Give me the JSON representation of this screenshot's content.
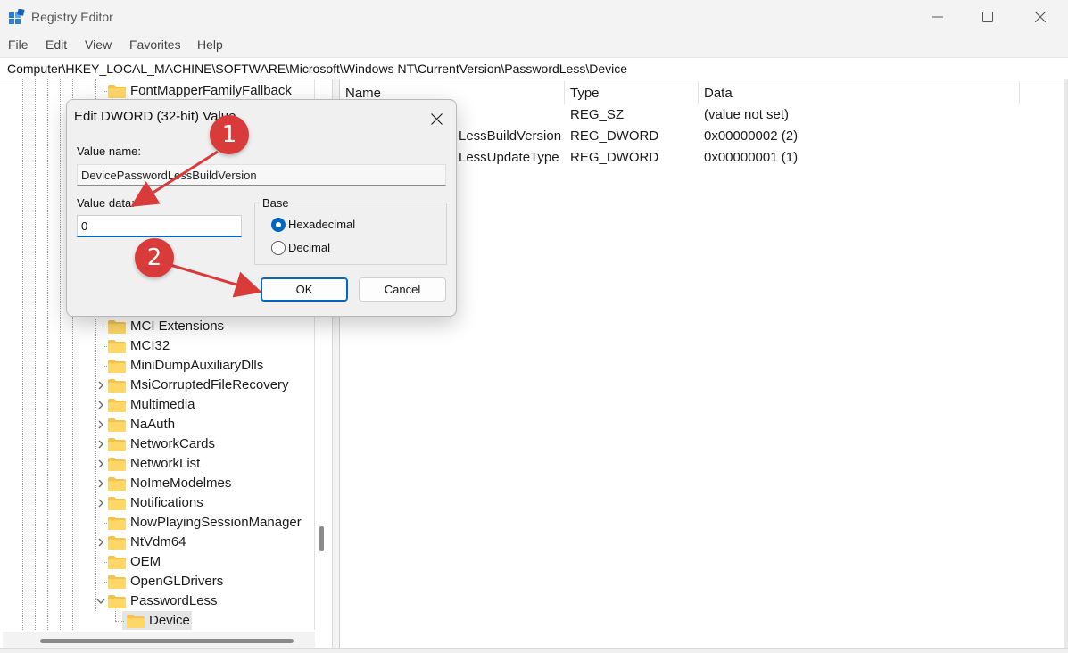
{
  "window": {
    "title": "Registry Editor",
    "icon": "registry-editor-icon",
    "controls": [
      "minimize-icon",
      "maximize-icon",
      "close-icon"
    ]
  },
  "menu": [
    "File",
    "Edit",
    "View",
    "Favorites",
    "Help"
  ],
  "address": "Computer\\HKEY_LOCAL_MACHINE\\SOFTWARE\\Microsoft\\Windows NT\\CurrentVersion\\PasswordLess\\Device",
  "tree": {
    "top_item": "FontMapperFamilyFallback",
    "items": [
      {
        "label": "MCI Extensions",
        "expandable": false
      },
      {
        "label": "MCI32",
        "expandable": false
      },
      {
        "label": "MiniDumpAuxiliaryDlls",
        "expandable": false
      },
      {
        "label": "MsiCorruptedFileRecovery",
        "expandable": true
      },
      {
        "label": "Multimedia",
        "expandable": true
      },
      {
        "label": "NaAuth",
        "expandable": true
      },
      {
        "label": "NetworkCards",
        "expandable": true
      },
      {
        "label": "NetworkList",
        "expandable": true
      },
      {
        "label": "NoImeModelmes",
        "expandable": true
      },
      {
        "label": "Notifications",
        "expandable": true
      },
      {
        "label": "NowPlayingSessionManager",
        "expandable": false
      },
      {
        "label": "NtVdm64",
        "expandable": true
      },
      {
        "label": "OEM",
        "expandable": false
      },
      {
        "label": "OpenGLDrivers",
        "expandable": false
      },
      {
        "label": "PasswordLess",
        "expandable": true,
        "expanded": true
      },
      {
        "label": "Device",
        "selected": true
      }
    ]
  },
  "list": {
    "headers": {
      "name": "Name",
      "type": "Type",
      "data": "Data"
    },
    "rows": [
      {
        "name": "",
        "type": "REG_SZ",
        "data": "(value not set)"
      },
      {
        "name": "LessBuildVersion",
        "type": "REG_DWORD",
        "data": "0x00000002 (2)"
      },
      {
        "name": "LessUpdateType",
        "type": "REG_DWORD",
        "data": "0x00000001 (1)"
      }
    ]
  },
  "dialog": {
    "title": "Edit DWORD (32-bit) Value",
    "value_name_label": "Value name:",
    "value_name": "DevicePasswordLessBuildVersion",
    "value_data_label": "Value data:",
    "value_data": "0",
    "base_label": "Base",
    "hex_label": "Hexadecimal",
    "dec_label": "Decimal",
    "selected_base": "Hexadecimal",
    "ok_label": "OK",
    "cancel_label": "Cancel"
  },
  "annotations": {
    "step1": "1",
    "step2": "2",
    "color": "#d93a3a"
  }
}
